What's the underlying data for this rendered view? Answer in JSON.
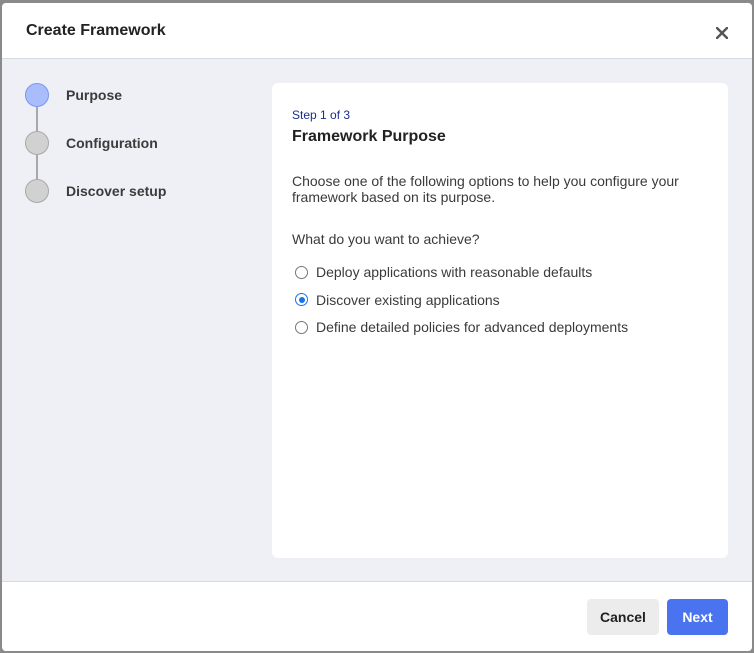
{
  "modal": {
    "title": "Create Framework",
    "close_icon": "close-icon"
  },
  "stepper": {
    "steps": [
      {
        "label": "Purpose",
        "state": "active"
      },
      {
        "label": "Configuration",
        "state": "pending"
      },
      {
        "label": "Discover setup",
        "state": "pending"
      }
    ]
  },
  "card": {
    "step_counter": "Step 1 of 3",
    "title": "Framework Purpose",
    "description": "Choose one of the following options to help you configure your framework based on its purpose.",
    "question": "What do you want to achieve?",
    "options": [
      {
        "label": "Deploy applications with reasonable defaults",
        "checked": false
      },
      {
        "label": "Discover existing applications",
        "checked": true
      },
      {
        "label": "Define detailed policies for advanced deployments",
        "checked": false
      }
    ]
  },
  "footer": {
    "cancel_label": "Cancel",
    "next_label": "Next"
  },
  "colors": {
    "accent": "#4a73f0",
    "active_step": "#a9bdfd",
    "radio_checked": "#1a73e8"
  }
}
